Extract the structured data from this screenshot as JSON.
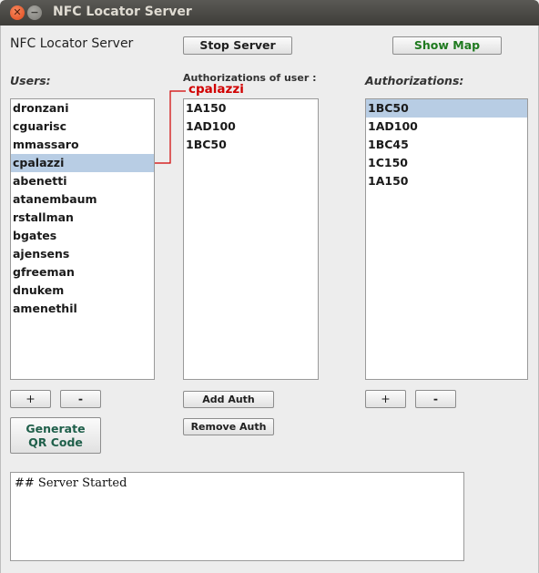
{
  "window": {
    "title": "NFC Locator Server"
  },
  "header": {
    "app_label": "NFC Locator Server",
    "stop_server": "Stop Server",
    "show_map": "Show Map"
  },
  "users": {
    "heading": "Users:",
    "items": [
      "dronzani",
      "cguarisc",
      "mmassaro",
      "cpalazzi",
      "abenetti",
      "atanembaum",
      "rstallman",
      "bgates",
      "ajensens",
      "gfreeman",
      "dnukem",
      "amenethil"
    ],
    "selected": "cpalazzi",
    "add_label": "+",
    "remove_label": "-",
    "qr_line1": "Generate",
    "qr_line2": "QR Code"
  },
  "user_auths": {
    "heading": "Authorizations of user :",
    "user_tag": "cpalazzi",
    "items": [
      "1A150",
      "1AD100",
      "1BC50"
    ],
    "add_auth": "Add Auth",
    "remove_auth": "Remove Auth"
  },
  "all_auths": {
    "heading": "Authorizations:",
    "items": [
      "1BC50",
      "1AD100",
      "1BC45",
      "1C150",
      "1A150"
    ],
    "selected": "1BC50",
    "add_label": "+",
    "remove_label": "-"
  },
  "log": {
    "text": "## Server Started"
  },
  "colors": {
    "accent_green": "#1f7a1f",
    "accent_teal": "#1f5f4a",
    "annotation_red": "#d10000",
    "selection": "#b8cde4"
  }
}
